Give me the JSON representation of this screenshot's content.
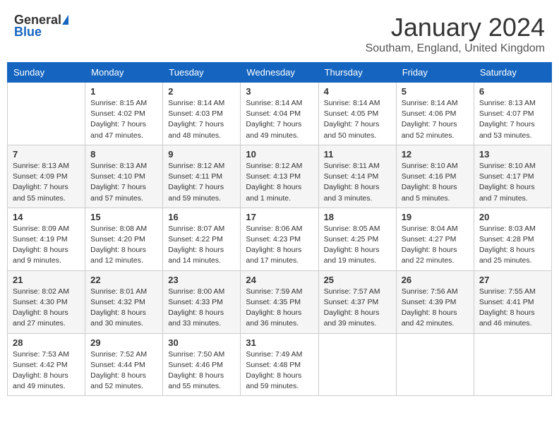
{
  "header": {
    "logo_general": "General",
    "logo_blue": "Blue",
    "month": "January 2024",
    "location": "Southam, England, United Kingdom"
  },
  "weekdays": [
    "Sunday",
    "Monday",
    "Tuesday",
    "Wednesday",
    "Thursday",
    "Friday",
    "Saturday"
  ],
  "weeks": [
    [
      {
        "day": "",
        "info": ""
      },
      {
        "day": "1",
        "info": "Sunrise: 8:15 AM\nSunset: 4:02 PM\nDaylight: 7 hours\nand 47 minutes."
      },
      {
        "day": "2",
        "info": "Sunrise: 8:14 AM\nSunset: 4:03 PM\nDaylight: 7 hours\nand 48 minutes."
      },
      {
        "day": "3",
        "info": "Sunrise: 8:14 AM\nSunset: 4:04 PM\nDaylight: 7 hours\nand 49 minutes."
      },
      {
        "day": "4",
        "info": "Sunrise: 8:14 AM\nSunset: 4:05 PM\nDaylight: 7 hours\nand 50 minutes."
      },
      {
        "day": "5",
        "info": "Sunrise: 8:14 AM\nSunset: 4:06 PM\nDaylight: 7 hours\nand 52 minutes."
      },
      {
        "day": "6",
        "info": "Sunrise: 8:13 AM\nSunset: 4:07 PM\nDaylight: 7 hours\nand 53 minutes."
      }
    ],
    [
      {
        "day": "7",
        "info": "Sunrise: 8:13 AM\nSunset: 4:09 PM\nDaylight: 7 hours\nand 55 minutes."
      },
      {
        "day": "8",
        "info": "Sunrise: 8:13 AM\nSunset: 4:10 PM\nDaylight: 7 hours\nand 57 minutes."
      },
      {
        "day": "9",
        "info": "Sunrise: 8:12 AM\nSunset: 4:11 PM\nDaylight: 7 hours\nand 59 minutes."
      },
      {
        "day": "10",
        "info": "Sunrise: 8:12 AM\nSunset: 4:13 PM\nDaylight: 8 hours\nand 1 minute."
      },
      {
        "day": "11",
        "info": "Sunrise: 8:11 AM\nSunset: 4:14 PM\nDaylight: 8 hours\nand 3 minutes."
      },
      {
        "day": "12",
        "info": "Sunrise: 8:10 AM\nSunset: 4:16 PM\nDaylight: 8 hours\nand 5 minutes."
      },
      {
        "day": "13",
        "info": "Sunrise: 8:10 AM\nSunset: 4:17 PM\nDaylight: 8 hours\nand 7 minutes."
      }
    ],
    [
      {
        "day": "14",
        "info": "Sunrise: 8:09 AM\nSunset: 4:19 PM\nDaylight: 8 hours\nand 9 minutes."
      },
      {
        "day": "15",
        "info": "Sunrise: 8:08 AM\nSunset: 4:20 PM\nDaylight: 8 hours\nand 12 minutes."
      },
      {
        "day": "16",
        "info": "Sunrise: 8:07 AM\nSunset: 4:22 PM\nDaylight: 8 hours\nand 14 minutes."
      },
      {
        "day": "17",
        "info": "Sunrise: 8:06 AM\nSunset: 4:23 PM\nDaylight: 8 hours\nand 17 minutes."
      },
      {
        "day": "18",
        "info": "Sunrise: 8:05 AM\nSunset: 4:25 PM\nDaylight: 8 hours\nand 19 minutes."
      },
      {
        "day": "19",
        "info": "Sunrise: 8:04 AM\nSunset: 4:27 PM\nDaylight: 8 hours\nand 22 minutes."
      },
      {
        "day": "20",
        "info": "Sunrise: 8:03 AM\nSunset: 4:28 PM\nDaylight: 8 hours\nand 25 minutes."
      }
    ],
    [
      {
        "day": "21",
        "info": "Sunrise: 8:02 AM\nSunset: 4:30 PM\nDaylight: 8 hours\nand 27 minutes."
      },
      {
        "day": "22",
        "info": "Sunrise: 8:01 AM\nSunset: 4:32 PM\nDaylight: 8 hours\nand 30 minutes."
      },
      {
        "day": "23",
        "info": "Sunrise: 8:00 AM\nSunset: 4:33 PM\nDaylight: 8 hours\nand 33 minutes."
      },
      {
        "day": "24",
        "info": "Sunrise: 7:59 AM\nSunset: 4:35 PM\nDaylight: 8 hours\nand 36 minutes."
      },
      {
        "day": "25",
        "info": "Sunrise: 7:57 AM\nSunset: 4:37 PM\nDaylight: 8 hours\nand 39 minutes."
      },
      {
        "day": "26",
        "info": "Sunrise: 7:56 AM\nSunset: 4:39 PM\nDaylight: 8 hours\nand 42 minutes."
      },
      {
        "day": "27",
        "info": "Sunrise: 7:55 AM\nSunset: 4:41 PM\nDaylight: 8 hours\nand 46 minutes."
      }
    ],
    [
      {
        "day": "28",
        "info": "Sunrise: 7:53 AM\nSunset: 4:42 PM\nDaylight: 8 hours\nand 49 minutes."
      },
      {
        "day": "29",
        "info": "Sunrise: 7:52 AM\nSunset: 4:44 PM\nDaylight: 8 hours\nand 52 minutes."
      },
      {
        "day": "30",
        "info": "Sunrise: 7:50 AM\nSunset: 4:46 PM\nDaylight: 8 hours\nand 55 minutes."
      },
      {
        "day": "31",
        "info": "Sunrise: 7:49 AM\nSunset: 4:48 PM\nDaylight: 8 hours\nand 59 minutes."
      },
      {
        "day": "",
        "info": ""
      },
      {
        "day": "",
        "info": ""
      },
      {
        "day": "",
        "info": ""
      }
    ]
  ]
}
